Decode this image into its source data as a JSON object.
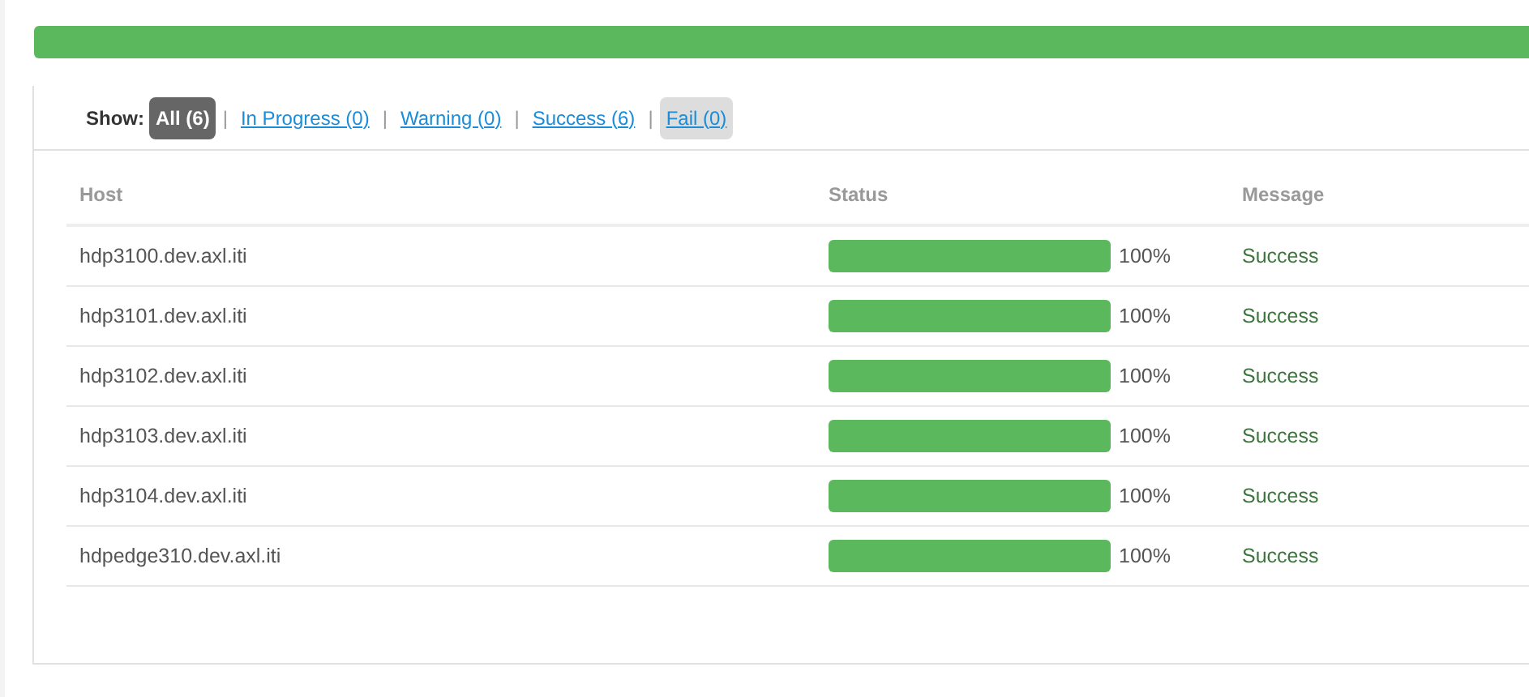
{
  "overall_progress": {
    "level": 1
  },
  "filter": {
    "label": "Show:",
    "options": [
      {
        "label": "All (6)",
        "selected": true,
        "highlighted": false
      },
      {
        "label": "In Progress (0)",
        "selected": false,
        "highlighted": false
      },
      {
        "label": "Warning (0)",
        "selected": false,
        "highlighted": false
      },
      {
        "label": "Success (6)",
        "selected": false,
        "highlighted": false
      },
      {
        "label": "Fail (0)",
        "selected": false,
        "highlighted": true
      }
    ],
    "separator": "|"
  },
  "table": {
    "columns": [
      "Host",
      "Status",
      "Message"
    ],
    "rows": [
      {
        "host": "hdp3100.dev.axl.iti",
        "level": 1,
        "reading": "100%",
        "message": "Success"
      },
      {
        "host": "hdp3101.dev.axl.iti",
        "level": 1,
        "reading": "100%",
        "message": "Success"
      },
      {
        "host": "hdp3102.dev.axl.iti",
        "level": 1,
        "reading": "100%",
        "message": "Success"
      },
      {
        "host": "hdp3103.dev.axl.iti",
        "level": 1,
        "reading": "100%",
        "message": "Success"
      },
      {
        "host": "hdp3104.dev.axl.iti",
        "level": 1,
        "reading": "100%",
        "message": "Success"
      },
      {
        "host": "hdpedge310.dev.axl.iti",
        "level": 1,
        "reading": "100%",
        "message": "Success"
      }
    ]
  }
}
